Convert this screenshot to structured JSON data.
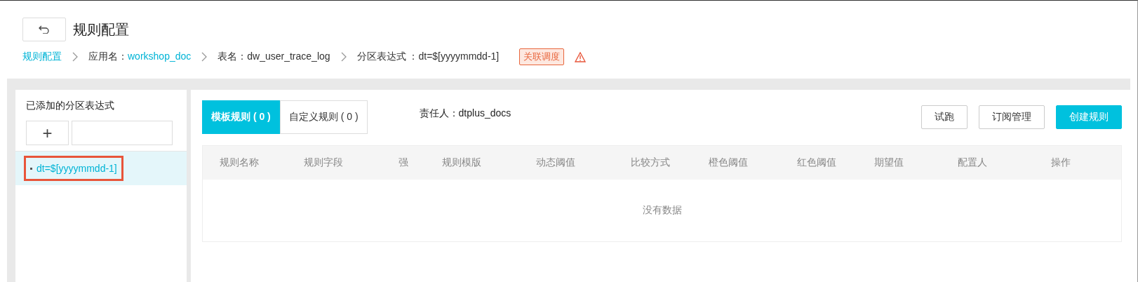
{
  "header": {
    "title": "规则配置"
  },
  "breadcrumb": [
    {
      "label": "规则配置",
      "link": true
    },
    {
      "prefix": "应用名：",
      "label": "workshop_doc",
      "link": true
    },
    {
      "prefix": "表名：",
      "label": "dw_user_trace_log",
      "link": false
    },
    {
      "prefix": "分区表达式 ：",
      "label": "dt=$[yyyymmdd-1]",
      "link": false
    }
  ],
  "tag": "关联调度",
  "partitions": {
    "title": "已添加的分区表达式",
    "add_label": "+",
    "items": [
      {
        "label": "dt=$[yyyymmdd-1]",
        "selected": true,
        "annotated": true
      }
    ]
  },
  "tabs": [
    {
      "label": "模板规则 ( 0 )",
      "selected": true
    },
    {
      "label": "自定义规则 ( 0 )",
      "selected": false
    }
  ],
  "owner": "责任人：dtplus_docs",
  "buttons": [
    {
      "label": "试跑",
      "primary": false
    },
    {
      "label": "订阅管理",
      "primary": false
    },
    {
      "label": "创建规则",
      "primary": true
    }
  ],
  "table": {
    "columns": [
      "规则名称",
      "规则字段",
      "强",
      "规则模版",
      "动态阈值",
      "比较方式",
      "橙色阈值",
      "红色阈值",
      "期望值",
      "配置人",
      "操作"
    ],
    "empty": "没有数据"
  }
}
